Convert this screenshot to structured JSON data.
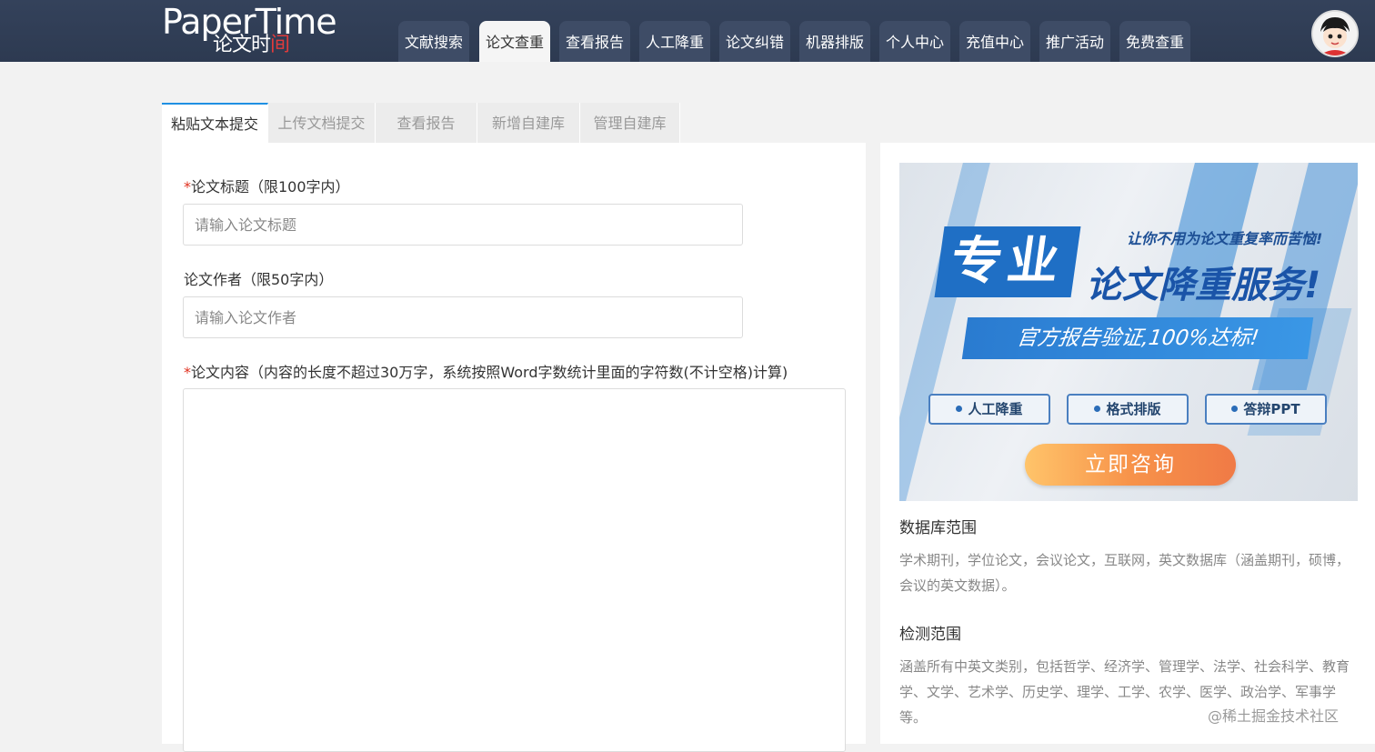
{
  "logo": {
    "line1": "PaperTime",
    "line2_a": "论文时",
    "line2_b": "间"
  },
  "nav": {
    "items": [
      "文献搜索",
      "论文查重",
      "查看报告",
      "人工降重",
      "论文纠错",
      "机器排版",
      "个人中心",
      "充值中心",
      "推广活动",
      "免费查重"
    ],
    "active_index": 1
  },
  "tabs": {
    "items": [
      "粘贴文本提交",
      "上传文档提交",
      "查看报告",
      "新增自建库",
      "管理自建库"
    ],
    "active_index": 0
  },
  "form": {
    "required_mark": "*",
    "title_label": "论文标题（限100字内）",
    "title_placeholder": "请输入论文标题",
    "author_label": "论文作者（限50字内）",
    "author_placeholder": "请输入论文作者",
    "content_label": "论文内容（内容的长度不超过30万字，系统按照Word字数统计里面的字符数(不计空格)计算)",
    "title_value": "",
    "author_value": "",
    "content_value": ""
  },
  "banner": {
    "tag": "专业",
    "subtitle": "让你不用为论文重复率而苦恼!",
    "main": "论文降重服务!",
    "strip": "官方报告验证,100%达标!",
    "buttons": [
      "人工降重",
      "格式排版",
      "答辩PPT"
    ],
    "cta": "立即咨询"
  },
  "sidebar": {
    "db_title": "数据库范围",
    "db_text": "学术期刊，学位论文，会议论文，互联网，英文数据库（涵盖期刊，硕博，会议的英文数据）。",
    "scope_title": "检测范围",
    "scope_text": "涵盖所有中英文类别，包括哲学、经济学、管理学、法学、社会科学、教育学、文学、艺术学、历史学、理学、工学、农学、医学、政治学、军事学等。"
  },
  "watermark": "@稀土掘金技术社区",
  "colors": {
    "nav_bg": "#2d3a51",
    "nav_item_bg": "#3e4c66",
    "accent": "#1f90e2",
    "required": "#e0301e",
    "cta": "#f7934a"
  }
}
